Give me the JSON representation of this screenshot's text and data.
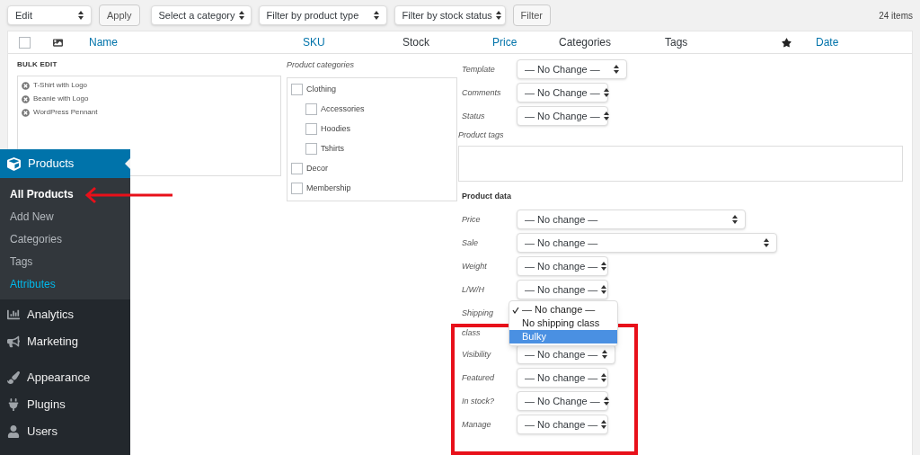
{
  "toolbar": {
    "bulk_action": "Edit",
    "apply": "Apply",
    "category_filter": "Select a category",
    "type_filter": "Filter by product type",
    "stock_filter": "Filter by stock status",
    "filter": "Filter",
    "item_count": "24 items"
  },
  "table": {
    "columns": [
      {
        "kind": "checkbox",
        "checked": false
      },
      {
        "kind": "image"
      },
      {
        "kind": "text",
        "label": "Name",
        "sortable": true
      },
      {
        "kind": "text",
        "label": "SKU",
        "sortable": true
      },
      {
        "kind": "text",
        "label": "Stock",
        "sortable": false
      },
      {
        "kind": "text",
        "label": "Price",
        "sortable": true
      },
      {
        "kind": "text",
        "label": "Categories",
        "sortable": false
      },
      {
        "kind": "text",
        "label": "Tags",
        "sortable": false
      },
      {
        "kind": "star"
      },
      {
        "kind": "text",
        "label": "Date",
        "sortable": true
      }
    ]
  },
  "bulk_edit": {
    "title": "BULK EDIT",
    "items": [
      "T-Shirt with Logo",
      "Beanie with Logo",
      "WordPress Pennant"
    ],
    "categories_label": "Product categories",
    "categories": [
      {
        "label": "Clothing",
        "checked": false,
        "children": [
          {
            "label": "Accessories",
            "checked": false
          },
          {
            "label": "Hoodies",
            "checked": false
          },
          {
            "label": "Tshirts",
            "checked": false
          }
        ]
      },
      {
        "label": "Decor",
        "checked": false
      },
      {
        "label": "Membership",
        "checked": false
      }
    ],
    "fields": [
      {
        "label": "Template",
        "value": "— No Change —"
      },
      {
        "label": "Comments",
        "value": "— No Change —"
      },
      {
        "label": "Status",
        "value": "— No Change —"
      }
    ],
    "tags_label": "Product tags",
    "product_data": {
      "title": "Product data",
      "fields": [
        {
          "label": "Price",
          "value": "— No change —"
        },
        {
          "label": "Sale",
          "value": "— No change —"
        },
        {
          "label": "Weight",
          "value": "— No change —"
        },
        {
          "label": "L/W/H",
          "value": "— No change —"
        },
        {
          "label": "Shipping class",
          "menu": [
            {
              "label": "— No change —",
              "selected": true,
              "highlighted": false
            },
            {
              "label": "No shipping class",
              "selected": false,
              "highlighted": false
            },
            {
              "label": "Bulky",
              "selected": false,
              "highlighted": true
            }
          ]
        },
        {
          "label": "Visibility",
          "value": "— No change —"
        },
        {
          "label": "Featured",
          "value": "— No change —"
        },
        {
          "label": "In stock?",
          "value": "— No Change —"
        },
        {
          "label": "Manage",
          "value": "— No change —"
        }
      ]
    }
  },
  "sidebar": {
    "current": {
      "label": "Products",
      "expanded": true,
      "submenu": [
        {
          "label": "All Products",
          "selected": true,
          "highlighted": false
        },
        {
          "label": "Add New",
          "selected": false,
          "highlighted": false
        },
        {
          "label": "Categories",
          "selected": false,
          "highlighted": false
        },
        {
          "label": "Tags",
          "selected": false,
          "highlighted": false
        },
        {
          "label": "Attributes",
          "selected": false,
          "highlighted": true
        }
      ]
    },
    "groups": [
      [
        "Analytics",
        "Marketing"
      ],
      [
        "Appearance",
        "Plugins",
        "Users"
      ]
    ]
  }
}
